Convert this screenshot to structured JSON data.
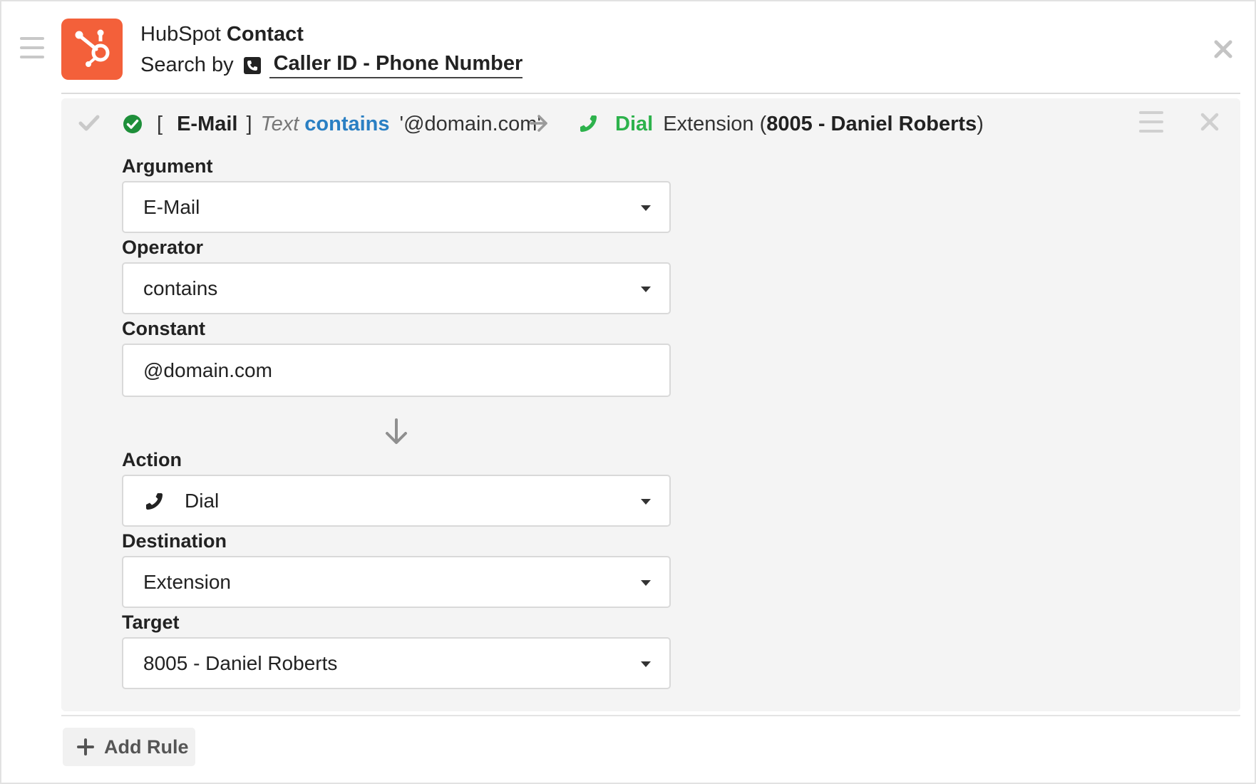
{
  "header": {
    "title_prefix": "HubSpot",
    "title_bold": "Contact",
    "search_prefix": "Search by",
    "search_field": "Caller ID - Phone Number",
    "brand_color": "#f3603a",
    "logo_icon": "hubspot-sprocket-icon",
    "close_icon": "close-icon",
    "drag_icon": "drag-handle-icon"
  },
  "rule": {
    "summary": {
      "open_bracket": "[",
      "argument": "E-Mail",
      "close_bracket": "]",
      "type": "Text",
      "operator": "contains",
      "constant": "'@domain.com'",
      "action": "Dial",
      "destination": "Extension (",
      "target": "8005 - Daniel Roberts",
      "close_paren": ")",
      "status_color": "#1e8f3a",
      "operator_color": "#2a7fc3",
      "action_color": "#2db24c"
    },
    "fields": {
      "argument_label": "Argument",
      "argument_value": "E-Mail",
      "operator_label": "Operator",
      "operator_value": "contains",
      "constant_label": "Constant",
      "constant_value": "@domain.com",
      "action_label": "Action",
      "action_value": "Dial",
      "destination_label": "Destination",
      "destination_value": "Extension",
      "target_label": "Target",
      "target_value": "8005 - Daniel Roberts"
    }
  },
  "footer": {
    "add_rule_label": "Add Rule"
  }
}
